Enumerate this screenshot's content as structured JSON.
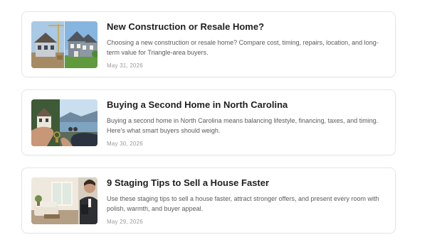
{
  "posts": [
    {
      "title": "New Construction or Resale Home?",
      "excerpt": "Choosing a new construction or resale home? Compare cost, timing, repairs, location, and long-term value for Triangle-area buyers.",
      "date": "May 31, 2026",
      "image": "new-construction-vs-resale-houses-photo"
    },
    {
      "title": "Buying a Second Home in North Carolina",
      "excerpt": "Buying a second home in North Carolina means balancing lifestyle, financing, taxes, and timing. Here’s what smart buyers should weigh.",
      "date": "May 30, 2026",
      "image": "keys-handover-lake-house-photo"
    },
    {
      "title": "9 Staging Tips to Sell a House Faster",
      "excerpt": "Use these staging tips to sell a house faster, attract stronger offers, and present every room with polish, warmth, and buyer appeal.",
      "date": "May 29, 2026",
      "image": "staged-living-room-agent-photo"
    }
  ]
}
